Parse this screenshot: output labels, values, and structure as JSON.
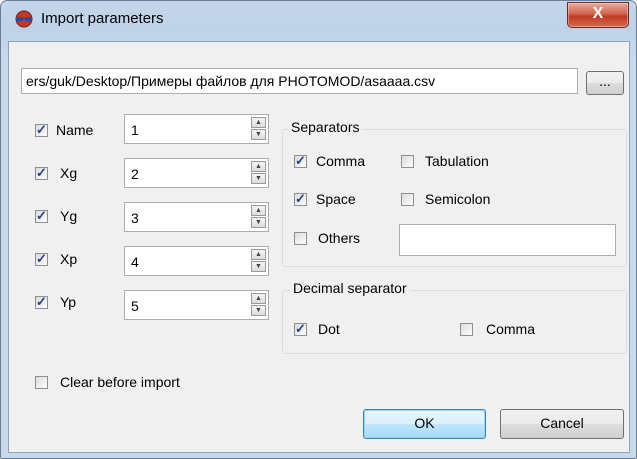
{
  "window": {
    "title": "Import parameters",
    "close_glyph": "X"
  },
  "file": {
    "path": "ers/guk/Desktop/Примеры файлов для PHOTOMOD/asaaaa.csv",
    "browse_label": "..."
  },
  "fields": [
    {
      "label": "Name",
      "checked": true,
      "value": "1"
    },
    {
      "label": "Xg",
      "checked": true,
      "value": "2"
    },
    {
      "label": "Yg",
      "checked": true,
      "value": "3"
    },
    {
      "label": "Xp",
      "checked": true,
      "value": "4"
    },
    {
      "label": "Yp",
      "checked": true,
      "value": "5"
    }
  ],
  "separators": {
    "title": "Separators",
    "comma": {
      "label": "Comma",
      "checked": true
    },
    "tabulation": {
      "label": "Tabulation",
      "checked": false
    },
    "space": {
      "label": "Space",
      "checked": true
    },
    "semicolon": {
      "label": "Semicolon",
      "checked": false
    },
    "others": {
      "label": "Others",
      "checked": false,
      "value": ""
    }
  },
  "decimal": {
    "title": "Decimal separator",
    "dot": {
      "label": "Dot",
      "checked": true
    },
    "comma": {
      "label": "Comma",
      "checked": false
    }
  },
  "clear_before_import": {
    "label": "Clear before import",
    "checked": false
  },
  "buttons": {
    "ok": "OK",
    "cancel": "Cancel"
  },
  "icons": {
    "app": "3d-glasses-icon",
    "close": "close-icon",
    "spin_up": "arrow-up-icon",
    "spin_down": "arrow-down-icon"
  }
}
